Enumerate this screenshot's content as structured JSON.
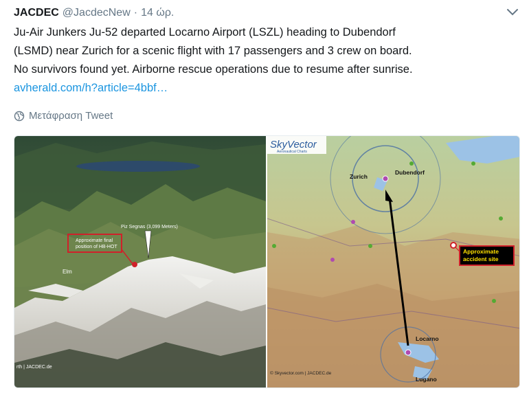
{
  "tweet": {
    "author_name": "JACDEC",
    "handle": "@JacdecNew",
    "dot": "·",
    "time": "14 ώρ.",
    "lines": [
      "Ju-Air Junkers Ju-52 departed Locarno Airport (LSZL) heading to Dubendorf",
      "(LSMD) near Zurich for a scenic flight with 17 passengers and 3 crew on board.",
      "No survivors found yet. Airborne rescue operations due to resume after sunrise."
    ],
    "link": "avherald.com/h?article=4bbf…",
    "translate_label": "Μετάφραση Tweet"
  },
  "left_image": {
    "peak_label": "Piz Segnas (3,099 Meters)",
    "callout_line1": "Approximate final",
    "callout_line2": "position of HB-HOT",
    "town": "Elm",
    "credit": "rth | JACDEC.de"
  },
  "right_image": {
    "logo": "SkyVector",
    "logo_sub": "Aeronautical Charts",
    "zurich": "Zurich",
    "dubendorf": "Dubendorf",
    "accident_line1": "Approximate",
    "accident_line2": "accident site",
    "locarno": "Locarno",
    "lugano": "Lugano",
    "credit": "© Skyvector.com | JACDEC.de"
  },
  "icons": {
    "globe": "globe-icon",
    "chevron": "chevron-down-icon"
  },
  "colors": {
    "link": "#1b95e0",
    "muted": "#657786",
    "callout_red": "#d0202a",
    "accident_bg": "#000000",
    "accident_text": "#ffe000"
  }
}
